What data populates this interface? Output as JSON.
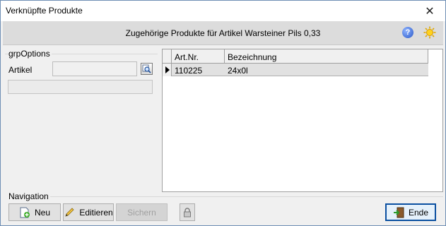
{
  "window": {
    "title": "Verknüpfte Produkte",
    "close_glyph": "✕"
  },
  "header": {
    "text": "Zugehörige Produkte für Artikel Warsteiner Pils 0,33",
    "help_glyph": "?"
  },
  "options": {
    "group_label": "grpOptions",
    "artikel_label": "Artikel",
    "artikel_value": "",
    "info_value": ""
  },
  "grid": {
    "columns": [
      "Art.Nr.",
      "Bezeichnung"
    ],
    "rows": [
      {
        "art_nr": "110225",
        "bezeichnung": "24x0l",
        "selected": true
      }
    ]
  },
  "navigation": {
    "label": "Navigation",
    "buttons": {
      "neu": "Neu",
      "editieren": "Editieren",
      "sichern": "Sichern",
      "ende": "Ende"
    }
  },
  "icons": {
    "help": "help-icon",
    "settings": "sun-icon",
    "lookup": "magnifier-icon",
    "neu": "new-document-icon",
    "editieren": "pencil-icon",
    "lock": "lock-icon",
    "ende": "exit-icon"
  },
  "colors": {
    "accent": "#0a4fa0",
    "header_bg": "#dcdcdc",
    "row_selected": "#e1e1e1"
  }
}
